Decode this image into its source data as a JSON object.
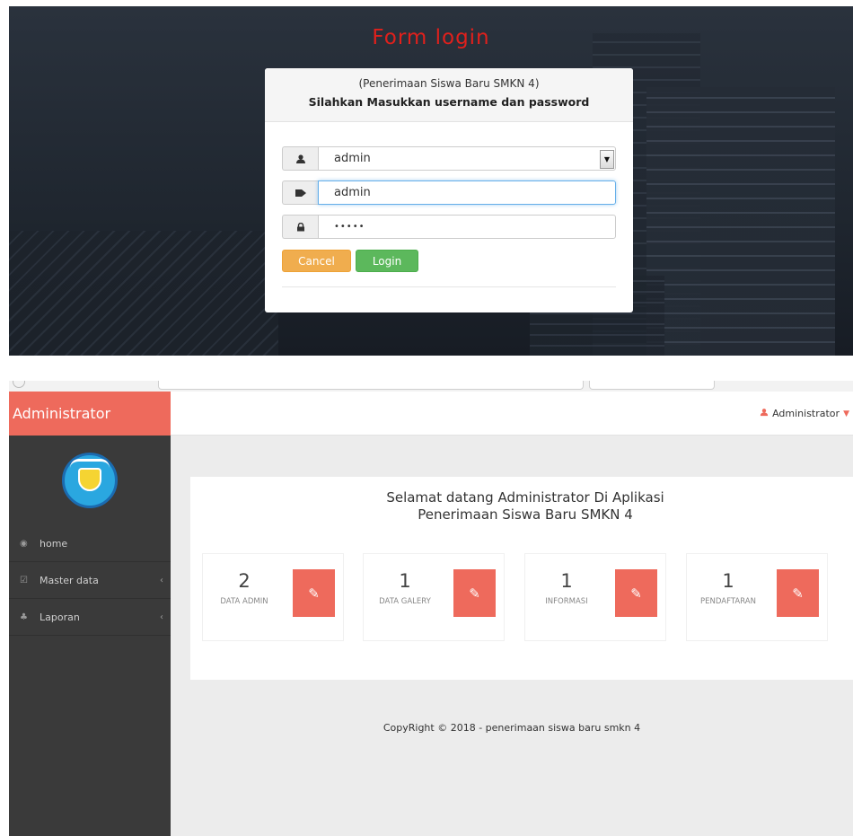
{
  "login": {
    "title": "Form login",
    "subtitle": "(Penerimaan Siswa Baru SMKN 4)",
    "instruction": "Silahkan Masukkan username dan password",
    "select_value": "admin",
    "username_value": "admin",
    "password_value": "•••••",
    "cancel_label": "Cancel",
    "login_label": "Login"
  },
  "admin": {
    "brand": "Administrator",
    "user_menu": "Administrator",
    "nav": [
      {
        "label": "home",
        "icon": "dashboard-icon"
      },
      {
        "label": "Master data",
        "icon": "edit-icon"
      },
      {
        "label": "Laporan",
        "icon": "sitemap-icon"
      }
    ],
    "welcome_line1": "Selamat datang Administrator Di Aplikasi",
    "welcome_line2": "Penerimaan Siswa Baru SMKN 4",
    "stats": [
      {
        "value": "2",
        "label": "DATA ADMIN"
      },
      {
        "value": "1",
        "label": "DATA GALERY"
      },
      {
        "value": "1",
        "label": "INFORMASI"
      },
      {
        "value": "1",
        "label": "PENDAFTARAN"
      }
    ],
    "footer": "CopyRight © 2018 - penerimaan siswa baru smkn 4"
  },
  "colors": {
    "accent": "#ee6a5c",
    "login_title": "#e0201c",
    "btn_warning": "#f0ad4e",
    "btn_success": "#5cb85c",
    "sidebar": "#3a3a3a"
  }
}
